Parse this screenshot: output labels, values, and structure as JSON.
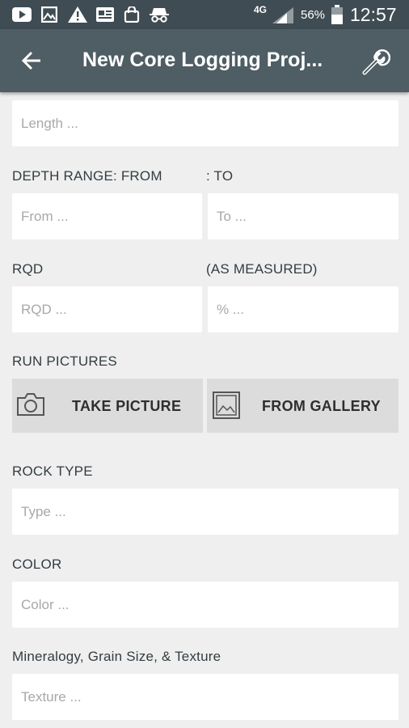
{
  "status_bar": {
    "network": "4G",
    "battery": "56%",
    "time": "12:57"
  },
  "app_bar": {
    "title": "New Core Logging Proj..."
  },
  "form": {
    "length_placeholder": "Length ...",
    "depth_from_label": "DEPTH RANGE: FROM",
    "depth_to_label": ": TO",
    "from_placeholder": "From ...",
    "to_placeholder": "To ...",
    "rqd_label": "RQD",
    "as_measured_label": "(AS MEASURED)",
    "rqd_placeholder": "RQD ...",
    "percent_placeholder": "% ...",
    "run_pictures_label": "RUN PICTURES",
    "take_picture_label": "TAKE PICTURE",
    "from_gallery_label": "FROM GALLERY",
    "rock_type_label": "ROCK TYPE",
    "type_placeholder": "Type ...",
    "color_label": "COLOR",
    "color_placeholder": "Color ...",
    "texture_label": "Mineralogy, Grain Size, & Texture",
    "texture_placeholder": "Texture ..."
  },
  "colors": {
    "status_bar": "#3f4c53",
    "app_bar": "#4f5d64",
    "background": "#efefef",
    "button": "#dcdcdc"
  }
}
